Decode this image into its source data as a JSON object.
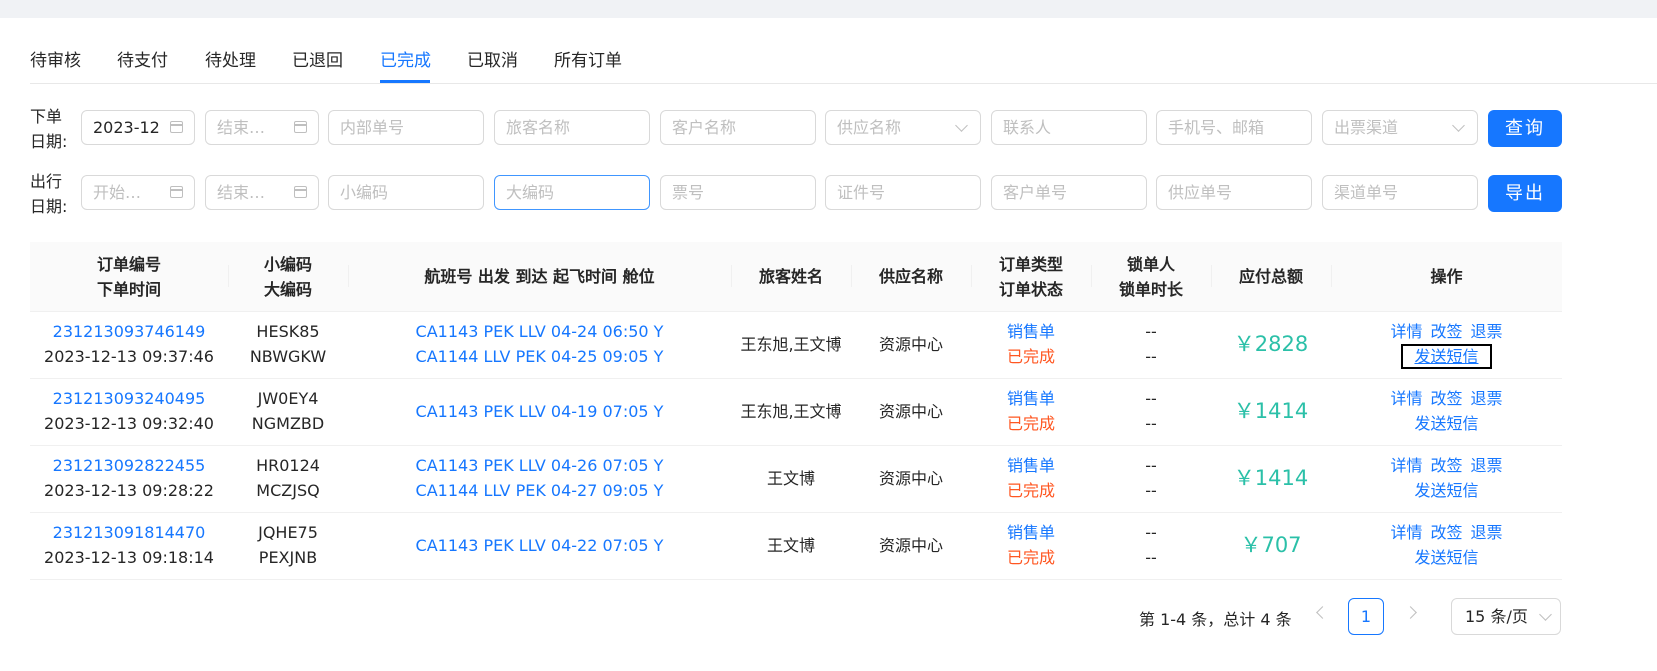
{
  "tabs": [
    {
      "label": "待审核"
    },
    {
      "label": "待支付"
    },
    {
      "label": "待处理"
    },
    {
      "label": "已退回"
    },
    {
      "label": "已完成",
      "active": true
    },
    {
      "label": "已取消"
    },
    {
      "label": "所有订单"
    }
  ],
  "filters": {
    "order_date_label_1": "下单",
    "order_date_label_2": "日期:",
    "travel_date_label_1": "出行",
    "travel_date_label_2": "日期:",
    "order_date_start_value": "2023-12-",
    "order_date_end_placeholder": "结束…",
    "internal_no_placeholder": "内部单号",
    "passenger_placeholder": "旅客名称",
    "customer_placeholder": "客户名称",
    "supplier_placeholder": "供应名称",
    "contact_placeholder": "联系人",
    "phone_email_placeholder": "手机号、邮箱",
    "channel_placeholder": "出票渠道",
    "travel_start_placeholder": "开始…",
    "travel_end_placeholder": "结束…",
    "small_code_placeholder": "小编码",
    "big_code_placeholder": "大编码",
    "ticket_no_placeholder": "票号",
    "id_no_placeholder": "证件号",
    "customer_order_placeholder": "客户单号",
    "supplier_order_placeholder": "供应单号",
    "channel_order_placeholder": "渠道单号",
    "query_button": "查询",
    "export_button": "导出"
  },
  "table": {
    "headers": {
      "order_no": "订单编号",
      "order_time": "下单时间",
      "small_code": "小编码",
      "big_code": "大编码",
      "flight": "航班号 出发 到达 起飞时间 舱位",
      "passenger": "旅客姓名",
      "supplier": "供应名称",
      "order_type": "订单类型",
      "order_status": "订单状态",
      "locker": "锁单人",
      "lock_duration": "锁单时长",
      "total": "应付总额",
      "actions": "操作"
    },
    "rows": [
      {
        "order_no": "231213093746149",
        "order_time": "2023-12-13 09:37:46",
        "small_code": "HESK85",
        "big_code": "NBWGKW",
        "flights": [
          "CA1143 PEK LLV 04-24 06:50 Y",
          "CA1144 LLV PEK 04-25 09:05 Y"
        ],
        "passenger": "王东旭,王文博",
        "supplier": "资源中心",
        "order_type": "销售单",
        "order_status": "已完成",
        "locker": "--",
        "lock_duration": "--",
        "total": "￥2828",
        "action_detail": "详情",
        "action_change": "改签",
        "action_refund": "退票",
        "action_sms": "发送短信"
      },
      {
        "order_no": "231213093240495",
        "order_time": "2023-12-13 09:32:40",
        "small_code": "JW0EY4",
        "big_code": "NGMZBD",
        "flights": [
          "CA1143 PEK LLV 04-19 07:05 Y"
        ],
        "passenger": "王东旭,王文博",
        "supplier": "资源中心",
        "order_type": "销售单",
        "order_status": "已完成",
        "locker": "--",
        "lock_duration": "--",
        "total": "￥1414",
        "action_detail": "详情",
        "action_change": "改签",
        "action_refund": "退票",
        "action_sms": "发送短信"
      },
      {
        "order_no": "231213092822455",
        "order_time": "2023-12-13 09:28:22",
        "small_code": "HR0124",
        "big_code": "MCZJSQ",
        "flights": [
          "CA1143 PEK LLV 04-26 07:05 Y",
          "CA1144 LLV PEK 04-27 09:05 Y"
        ],
        "passenger": "王文博",
        "supplier": "资源中心",
        "order_type": "销售单",
        "order_status": "已完成",
        "locker": "--",
        "lock_duration": "--",
        "total": "￥1414",
        "action_detail": "详情",
        "action_change": "改签",
        "action_refund": "退票",
        "action_sms": "发送短信"
      },
      {
        "order_no": "231213091814470",
        "order_time": "2023-12-13 09:18:14",
        "small_code": "JQHE75",
        "big_code": "PEXJNB",
        "flights": [
          "CA1143 PEK LLV 04-22 07:05 Y"
        ],
        "passenger": "王文博",
        "supplier": "资源中心",
        "order_type": "销售单",
        "order_status": "已完成",
        "locker": "--",
        "lock_duration": "--",
        "total": "￥707",
        "action_detail": "详情",
        "action_change": "改签",
        "action_refund": "退票",
        "action_sms": "发送短信"
      }
    ]
  },
  "pagination": {
    "summary": "第 1-4 条，总计 4 条",
    "current_page": "1",
    "page_size": "15 条/页"
  },
  "colors": {
    "primary": "#1677ff",
    "status_done": "#ff5722",
    "amount": "#2bc0a8"
  }
}
